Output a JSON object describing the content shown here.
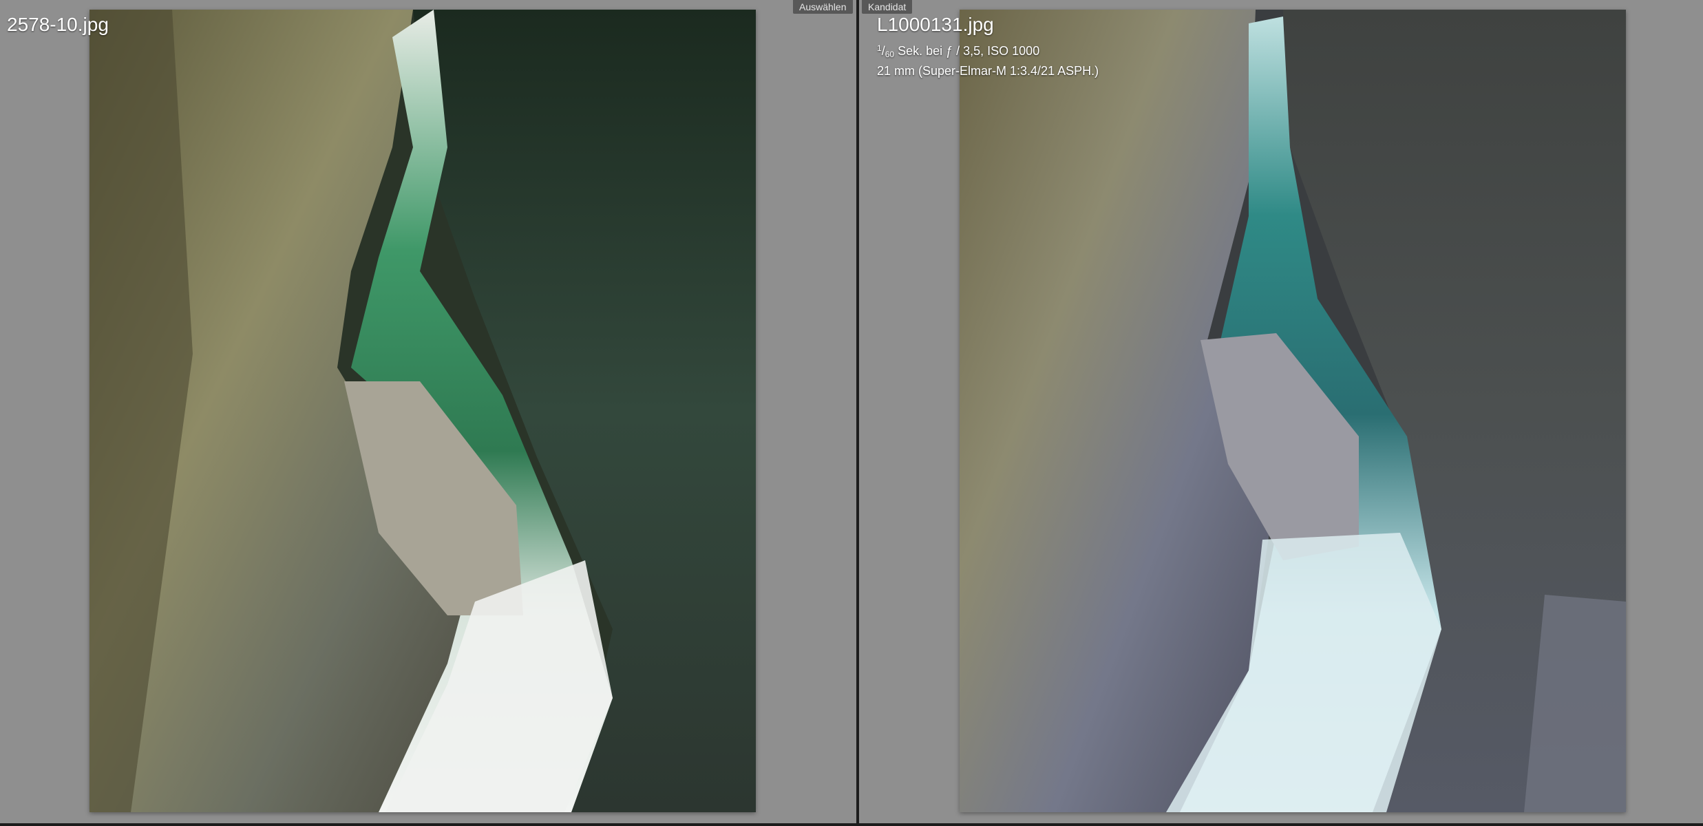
{
  "compare": {
    "left": {
      "tag": "Auswählen",
      "filename": "2578-10.jpg"
    },
    "right": {
      "tag": "Kandidat",
      "filename": "L1000131.jpg",
      "exposure_num": "1",
      "exposure_den": "60",
      "exposure_rest": "Sek. bei ƒ / 3,5, ISO 1000",
      "lens": "21 mm (Super-Elmar-M 1:3.4/21 ASPH.)"
    }
  },
  "colors": {
    "background": "#8f8f8f",
    "divider": "#1c1c1c",
    "tag_bg": "#585858"
  },
  "icons": []
}
